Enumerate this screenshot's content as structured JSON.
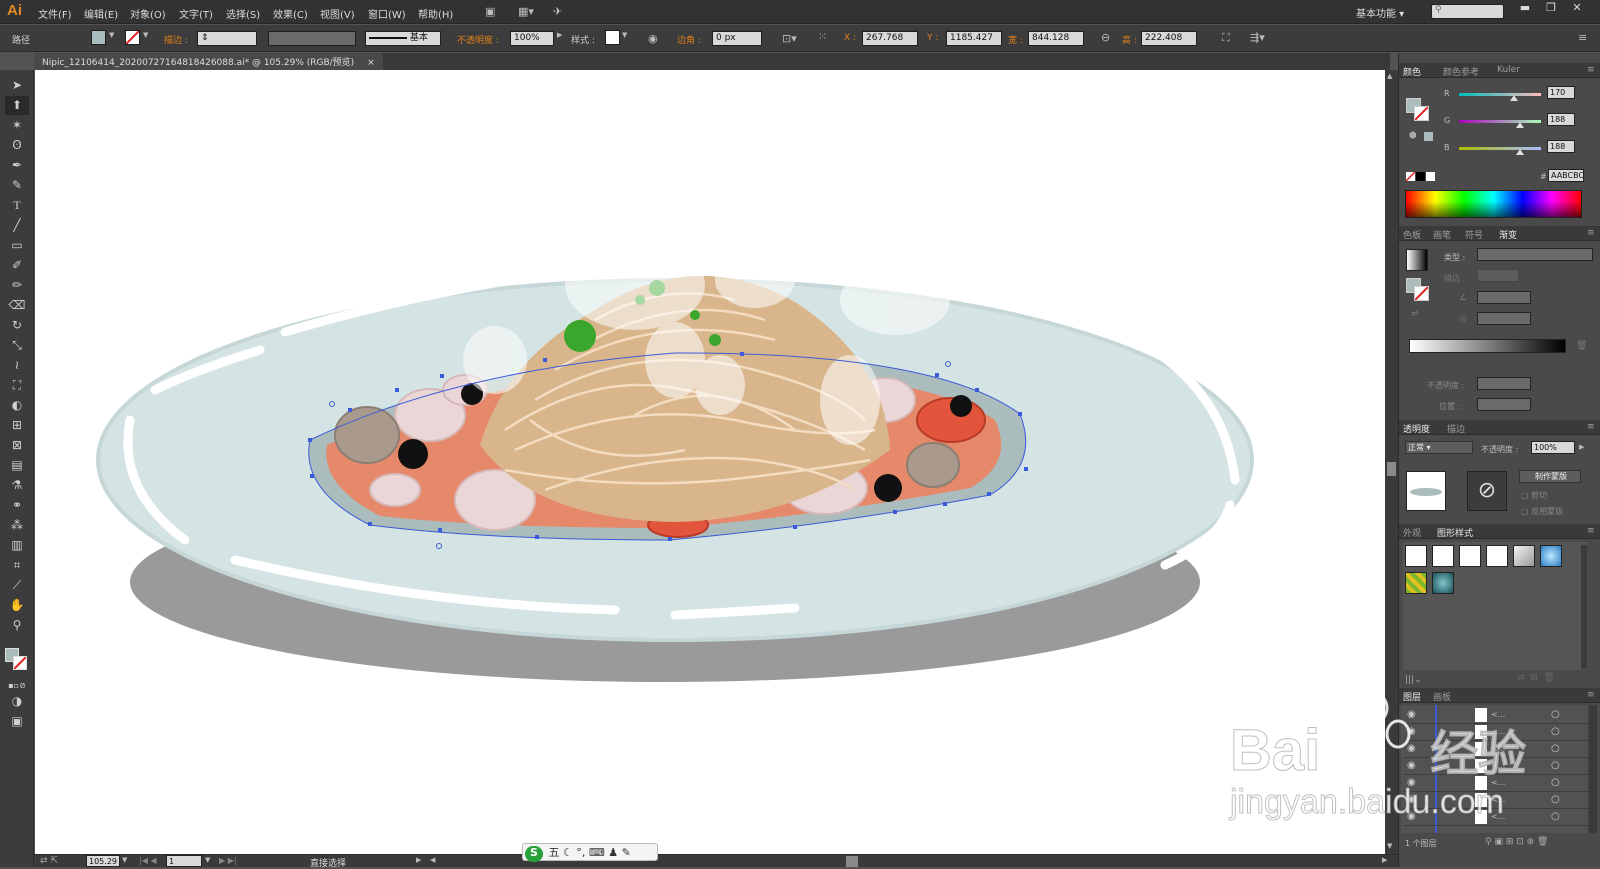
{
  "app": {
    "logo": "Ai",
    "menu": [
      "文件(F)",
      "编辑(E)",
      "对象(O)",
      "文字(T)",
      "选择(S)",
      "效果(C)",
      "视图(V)",
      "窗口(W)",
      "帮助(H)"
    ],
    "workspace": "基本功能"
  },
  "control": {
    "object_type": "路径",
    "stroke_label": "描边 :",
    "stroke_style": "基本",
    "opacity_label": "不透明度 :",
    "opacity": "100%",
    "style_label": "样式 :",
    "corner_label": "边角 :",
    "corner": "0 px",
    "x_label": "X :",
    "x": "267.768",
    "y_label": "Y :",
    "y": "1185.427",
    "w_label": "宽 :",
    "w": "844.128",
    "h_label": "高 :",
    "h": "222.408"
  },
  "document": {
    "tab": "Nipic_12106414_20200727164818426088.ai* @ 105.29% (RGB/预览)"
  },
  "tools": [
    "selection",
    "direct-selection",
    "magic-wand",
    "lasso",
    "pen",
    "curvature",
    "type",
    "line-segment",
    "rectangle",
    "paintbrush",
    "pencil",
    "eraser",
    "rotate",
    "scale",
    "warp",
    "free-transform",
    "shape-builder",
    "perspective-grid",
    "mesh",
    "gradient",
    "eyedropper",
    "blend",
    "symbol-sprayer",
    "column-graph",
    "artboard",
    "slice",
    "hand",
    "zoom"
  ],
  "status": {
    "zoom": "105.29",
    "page": "1",
    "tool": "直接选择"
  },
  "ime": {
    "items": [
      "五",
      "☾",
      "°,",
      "⌨",
      "♟",
      "✎"
    ]
  },
  "color_panel": {
    "tabs": [
      "颜色",
      "颜色参考",
      "Kuler"
    ],
    "r_label": "R",
    "r": "170",
    "g_label": "G",
    "g": "188",
    "b_label": "B",
    "b": "188",
    "hex_prefix": "#",
    "hex": "AABCBC"
  },
  "gradient_panel": {
    "tabs": [
      "色板",
      "画笔",
      "符号",
      "渐变"
    ],
    "type_label": "类型 :",
    "stroke_label": "描边 :",
    "opacity_label": "不透明度 :",
    "position_label": "位置 :"
  },
  "transparency_panel": {
    "tabs": [
      "透明度",
      "描边"
    ],
    "blend_mode": "正常",
    "opacity_label": "不透明度 :",
    "opacity": "100%",
    "make_mask": "制作蒙版",
    "clip": "剪切",
    "invert": "反相蒙版"
  },
  "appearance_panel": {
    "tabs": [
      "外观",
      "图形样式"
    ]
  },
  "layers_panel": {
    "tabs": [
      "图层",
      "画板"
    ],
    "row_text": "<...",
    "row_count": 8,
    "footer": "1 个图层"
  },
  "watermark": {
    "brand_left": "Bai",
    "brand_right": "经验",
    "url": "jingyan.baidu.com"
  },
  "colors": {
    "plate": "#d4e3e3",
    "plate_shadow": "#9a9a9a",
    "sauce": "#e6886a",
    "noodles": "#d9b58c",
    "selection": "#3b5bd9",
    "fill_swatch": "#aabcbc"
  }
}
